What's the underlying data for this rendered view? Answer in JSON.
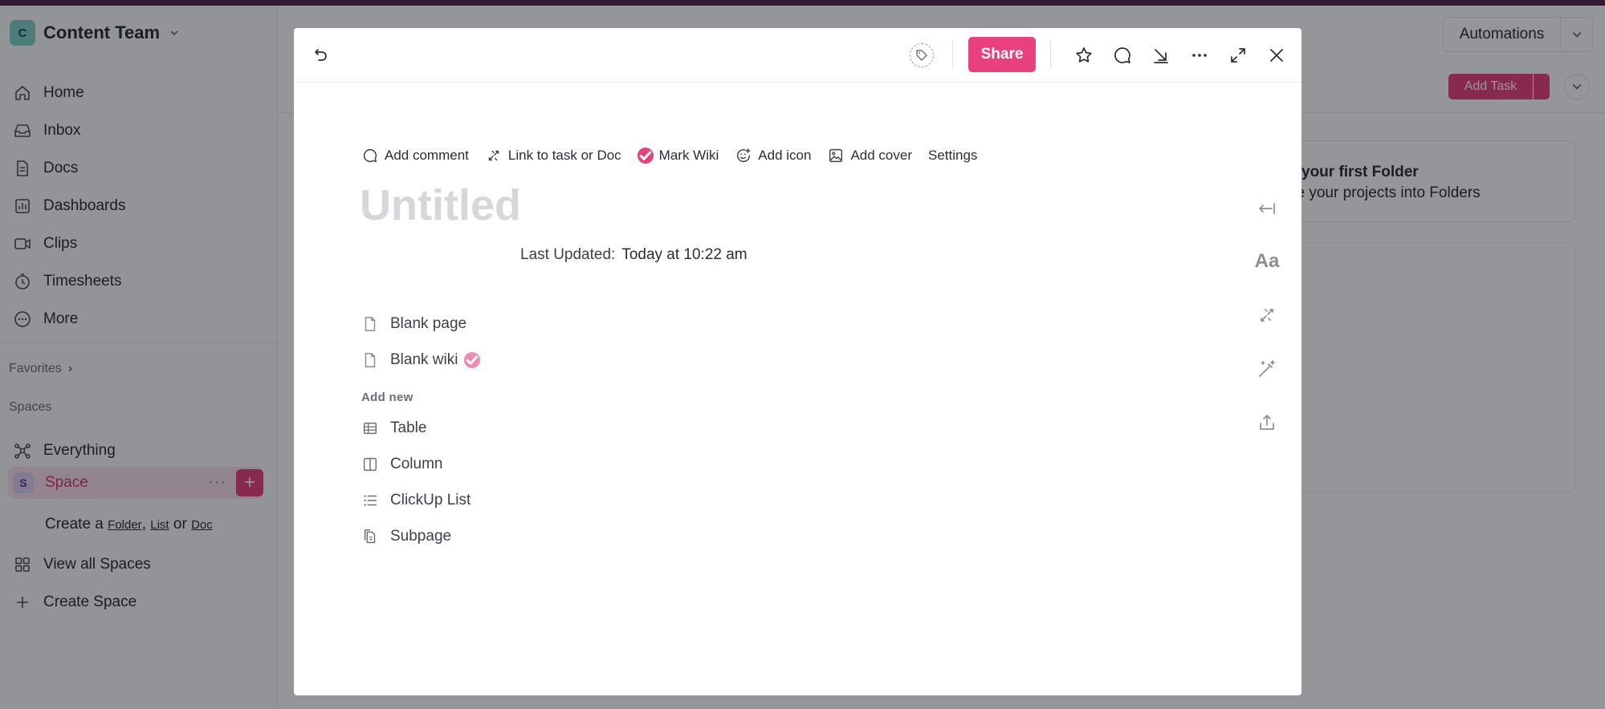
{
  "workspace": {
    "initial": "C",
    "name": "Content Team"
  },
  "sidebar": {
    "nav": [
      {
        "label": "Home",
        "icon": "home-icon"
      },
      {
        "label": "Inbox",
        "icon": "inbox-icon"
      },
      {
        "label": "Docs",
        "icon": "docs-icon"
      },
      {
        "label": "Dashboards",
        "icon": "dashboards-icon"
      },
      {
        "label": "Clips",
        "icon": "clips-icon"
      },
      {
        "label": "Timesheets",
        "icon": "timesheets-icon"
      },
      {
        "label": "More",
        "icon": "more-icon"
      }
    ],
    "favorites_label": "Favorites",
    "spaces_label": "Spaces",
    "everything_label": "Everything",
    "space": {
      "initial": "S",
      "name": "Space"
    },
    "create": {
      "prefix": "Create a",
      "folder": "Folder",
      "comma": ",",
      "list": "List",
      "or": "or",
      "doc": "Doc"
    },
    "view_all_spaces": "View all Spaces",
    "create_space": "Create Space"
  },
  "header": {
    "automations_label": "Automations",
    "add_task_label": "Add Task"
  },
  "folder_card": {
    "title": "your first Folder",
    "subtitle": "ze your projects into Folders"
  },
  "modal": {
    "share_label": "Share",
    "actions": {
      "add_comment": "Add comment",
      "link": "Link to task or Doc",
      "mark_wiki": "Mark Wiki",
      "add_icon": "Add icon",
      "add_cover": "Add cover",
      "settings": "Settings"
    },
    "title_placeholder": "Untitled",
    "last_updated_label": "Last Updated:",
    "last_updated_value": "Today at 10:22 am",
    "templates": [
      {
        "label": "Blank page"
      },
      {
        "label": "Blank wiki"
      }
    ],
    "add_new_label": "Add new",
    "add_new": [
      {
        "label": "Table"
      },
      {
        "label": "Column"
      },
      {
        "label": "ClickUp List"
      },
      {
        "label": "Subpage"
      }
    ],
    "rail_font_label": "Aa"
  },
  "colors": {
    "accent": "#e8417e",
    "top_bar": "#4f2a4c",
    "workspace_avatar": "#7dd3c8"
  }
}
